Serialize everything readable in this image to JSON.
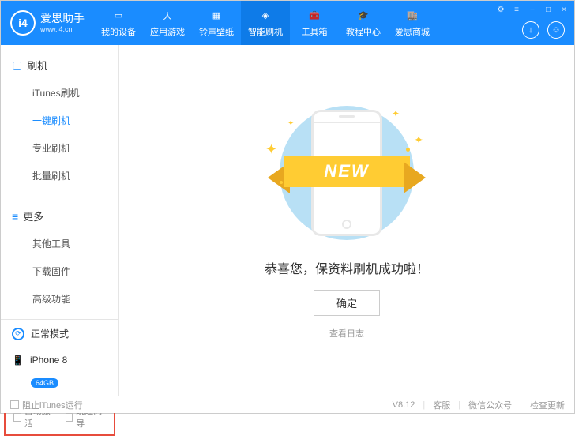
{
  "logo": {
    "badge": "i4",
    "title": "爱思助手",
    "sub": "www.i4.cn"
  },
  "nav": [
    {
      "label": "我的设备",
      "icon": "phone"
    },
    {
      "label": "应用游戏",
      "icon": "app"
    },
    {
      "label": "铃声壁纸",
      "icon": "ring"
    },
    {
      "label": "智能刷机",
      "icon": "flash",
      "active": true
    },
    {
      "label": "工具箱",
      "icon": "tool"
    },
    {
      "label": "教程中心",
      "icon": "edu"
    },
    {
      "label": "爱思商城",
      "icon": "shop"
    }
  ],
  "sidebar": {
    "groups": [
      {
        "title": "刷机",
        "icon": "▢",
        "items": [
          "iTunes刷机",
          "一键刷机",
          "专业刷机",
          "批量刷机"
        ],
        "activeIndex": 1
      },
      {
        "title": "更多",
        "icon": "≡",
        "items": [
          "其他工具",
          "下载固件",
          "高级功能"
        ]
      }
    ],
    "mode": "正常模式",
    "device": {
      "name": "iPhone 8",
      "storage": "64GB"
    },
    "checks": [
      "自动激活",
      "跳过向导"
    ]
  },
  "main": {
    "ribbon": "NEW",
    "success": "恭喜您，保资料刷机成功啦！",
    "ok": "确定",
    "log": "查看日志"
  },
  "footer": {
    "block": "阻止iTunes运行",
    "version": "V8.12",
    "links": [
      "客服",
      "微信公众号",
      "检查更新"
    ]
  }
}
